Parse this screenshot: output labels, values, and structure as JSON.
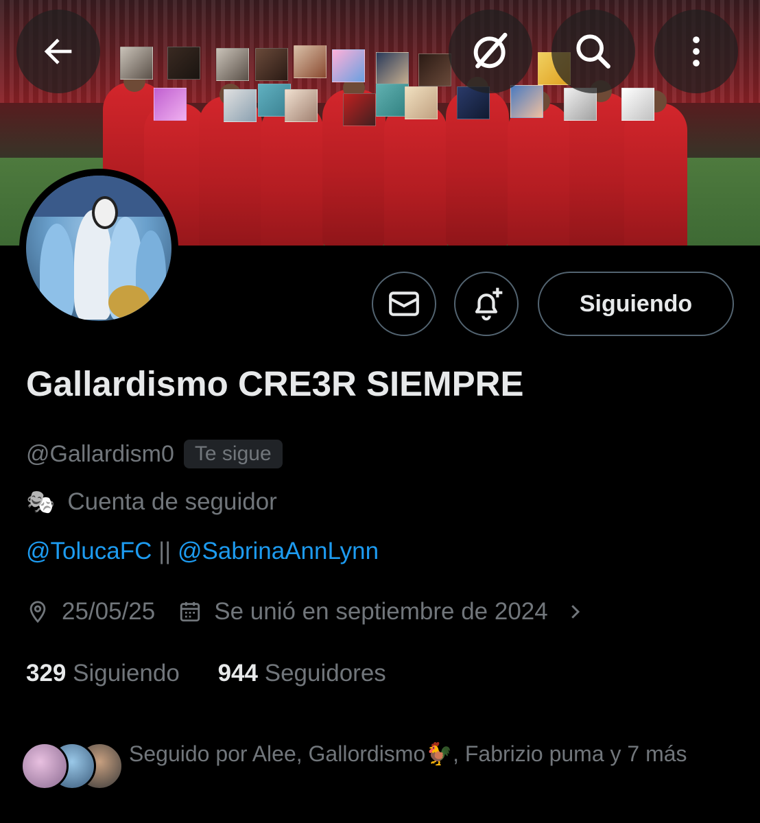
{
  "topbar": {
    "back_icon": "arrow-left-icon",
    "grok_icon": "grok-icon",
    "search_icon": "search-icon",
    "more_icon": "more-vertical-icon"
  },
  "profile": {
    "display_name": "Gallardismo CRE3R SIEMPRE",
    "handle": "@Gallardism0",
    "follows_you_badge": "Te sigue",
    "bio_emoji": "🎭",
    "bio_text": "Cuenta de seguidor",
    "link_1": "@TolucaFC",
    "link_separator": "||",
    "link_2": "@SabrinaAnnLynn",
    "location": "25/05/25",
    "joined": "Se unió en septiembre de 2024"
  },
  "actions": {
    "message_icon": "envelope-icon",
    "notify_icon": "bell-plus-icon",
    "follow_button": "Siguiendo"
  },
  "stats": {
    "following_count": "329",
    "following_label": "Siguiendo",
    "followers_count": "944",
    "followers_label": "Seguidores"
  },
  "followed_by": {
    "text": "Seguido por Alee, Gallordismo🐓, Fabrizio puma y 7 más"
  },
  "colors": {
    "background": "#000000",
    "primary_text": "#e7e9ea",
    "secondary_text": "#71767b",
    "link": "#1d9bf0",
    "border": "#536471"
  }
}
